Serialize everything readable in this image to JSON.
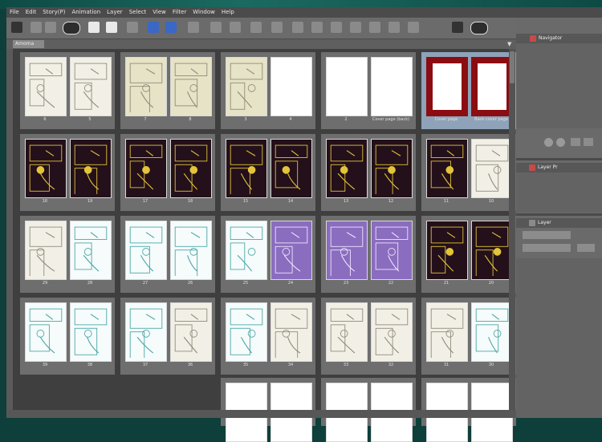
{
  "menubar": {
    "items": [
      "File",
      "Edit",
      "Story(P)",
      "Animation",
      "Layer",
      "Select",
      "View",
      "Filter",
      "Window",
      "Help"
    ]
  },
  "tab": {
    "title": "Amoma"
  },
  "right_panel": {
    "navigator_title": "Navigator",
    "layer_title": "Layer Pr",
    "layer2_title": "Layer"
  },
  "spreads": [
    {
      "left_label": "6",
      "right_label": "5",
      "left_style": "sketch",
      "right_style": "sketch"
    },
    {
      "left_label": "7",
      "right_label": "8",
      "left_style": "yellowish",
      "right_style": "yellowish"
    },
    {
      "left_label": "3",
      "right_label": "4",
      "left_style": "yellowish",
      "right_style": "blank"
    },
    {
      "left_label": "2",
      "right_label": "Cover page (back)",
      "left_style": "blank",
      "right_style": "blank"
    },
    {
      "left_label": "Cover page",
      "right_label": "Back cover page",
      "left_style": "red",
      "right_style": "red",
      "selected": true
    },
    {
      "left_label": "16",
      "right_label": "19",
      "left_style": "dark",
      "right_style": "dark"
    },
    {
      "left_label": "17",
      "right_label": "18",
      "left_style": "dark",
      "right_style": "dark"
    },
    {
      "left_label": "15",
      "right_label": "14",
      "left_style": "dark",
      "right_style": "dark"
    },
    {
      "left_label": "13",
      "right_label": "12",
      "left_style": "dark",
      "right_style": "dark"
    },
    {
      "left_label": "11",
      "right_label": "10",
      "left_style": "dark",
      "right_style": "sketch"
    },
    {
      "left_label": "29",
      "right_label": "28",
      "left_style": "sketch",
      "right_style": "teal"
    },
    {
      "left_label": "27",
      "right_label": "26",
      "left_style": "teal",
      "right_style": "teal"
    },
    {
      "left_label": "25",
      "right_label": "24",
      "left_style": "teal",
      "right_style": "purple"
    },
    {
      "left_label": "23",
      "right_label": "22",
      "left_style": "purple",
      "right_style": "purple"
    },
    {
      "left_label": "21",
      "right_label": "20",
      "left_style": "dark",
      "right_style": "dark"
    },
    {
      "left_label": "39",
      "right_label": "38",
      "left_style": "teal",
      "right_style": "teal"
    },
    {
      "left_label": "37",
      "right_label": "36",
      "left_style": "teal",
      "right_style": "sketch"
    },
    {
      "left_label": "35",
      "right_label": "34",
      "left_style": "teal",
      "right_style": "sketch"
    },
    {
      "left_label": "33",
      "right_label": "32",
      "left_style": "sketch",
      "right_style": "sketch"
    },
    {
      "left_label": "31",
      "right_label": "30",
      "left_style": "sketch",
      "right_style": "teal"
    },
    {
      "left_label": "",
      "right_label": "",
      "left_style": "blank",
      "right_style": "blank"
    },
    {
      "left_label": "",
      "right_label": "",
      "left_style": "blank",
      "right_style": "blank"
    },
    {
      "left_label": "",
      "right_label": "",
      "left_style": "blank",
      "right_style": "blank"
    }
  ],
  "colors": {
    "bg_teal": "#0f3f3a",
    "panel": "#6e6e6e",
    "selected_spread": "#8ea3b9",
    "cover_red": "#8b0d12",
    "ink_yellow": "#e3c43a",
    "ink_teal": "#4aa6a6"
  }
}
